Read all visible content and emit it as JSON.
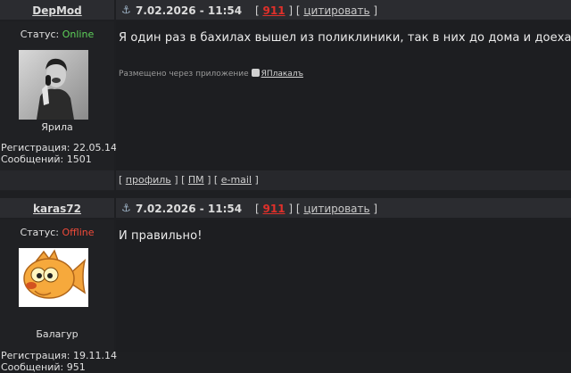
{
  "posts": [
    {
      "username": "DepMod",
      "date": "7.02.2026 - 11:54",
      "post_number": "911",
      "quote_label": "цитировать",
      "status_label": "Статус: ",
      "status": "Online",
      "rank": "Ярила",
      "registration": "Регистрация: 22.05.14",
      "messages": "Сообщений: 1501",
      "text": "Я один раз в бахилах вышел из поликлиники, так в них до дома и доехал",
      "via_label": "Размещено через приложение",
      "via_app": "ЯПлакалъ",
      "footer": {
        "profile": "профиль",
        "pm": "ПМ",
        "email": "e-mail"
      },
      "avatar_icon": "singer-photo"
    },
    {
      "username": "karas72",
      "date": "7.02.2026 - 11:54",
      "post_number": "911",
      "quote_label": "цитировать",
      "status_label": "Статус: ",
      "status": "Offline",
      "rank": "Балагур",
      "registration": "Регистрация: 19.11.14",
      "messages": "Сообщений: 951",
      "text": "И правильно!",
      "avatar_icon": "goldfish-cartoon"
    }
  ],
  "colors": {
    "online": "#5ed25a",
    "offline": "#f04a3a",
    "post_number": "#e0302a",
    "background": "#1e1f22"
  }
}
